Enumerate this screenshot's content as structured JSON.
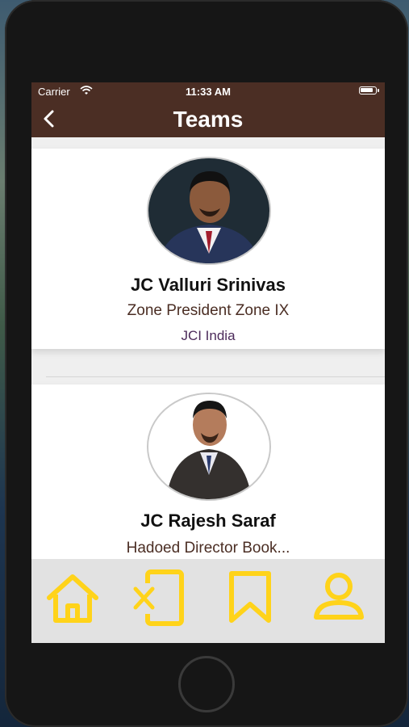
{
  "status_bar": {
    "carrier": "Carrier",
    "time": "11:33 AM"
  },
  "nav": {
    "title": "Teams",
    "back_icon": "chevron-left-icon"
  },
  "members": [
    {
      "name": "JC Valluri Srinivas",
      "role": "Zone President Zone IX",
      "org": "JCI India"
    },
    {
      "name": "JC Rajesh Saraf",
      "role": "Hadoed Director Book..."
    }
  ],
  "tabs": [
    {
      "icon": "home-icon"
    },
    {
      "icon": "phone-cancel-icon"
    },
    {
      "icon": "bookmark-icon"
    },
    {
      "icon": "profile-icon"
    }
  ],
  "colors": {
    "header": "#4b2e24",
    "accent": "#ffd31a",
    "role_text": "#4b2e24",
    "org_text": "#4b2a5a"
  }
}
